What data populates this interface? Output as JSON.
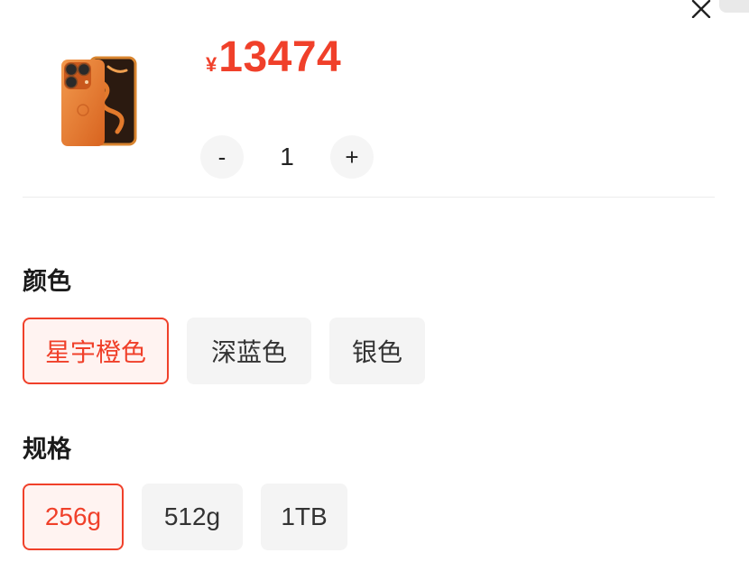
{
  "product": {
    "price_currency": "¥",
    "price_value": "13474",
    "quantity": "1",
    "decrement_label": "-",
    "increment_label": "+",
    "close_label": "×"
  },
  "colors": {
    "accent": "#f0402a",
    "chip_bg": "#f4f4f4",
    "selected_bg": "#fff3f1",
    "product_orange": "#e8742a"
  },
  "color_section": {
    "title": "颜色",
    "options": [
      {
        "label": "星宇橙色",
        "selected": true
      },
      {
        "label": "深蓝色",
        "selected": false
      },
      {
        "label": "银色",
        "selected": false
      }
    ]
  },
  "spec_section": {
    "title": "规格",
    "options": [
      {
        "label": "256g",
        "selected": true
      },
      {
        "label": "512g",
        "selected": false
      },
      {
        "label": "1TB",
        "selected": false
      }
    ]
  }
}
